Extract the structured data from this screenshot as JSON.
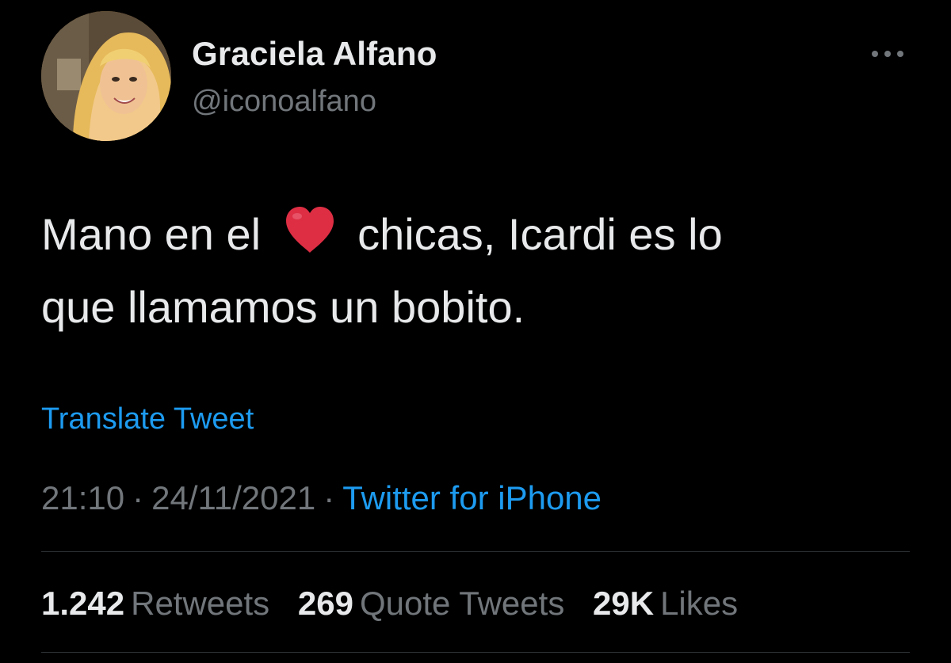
{
  "author": {
    "name": "Graciela Alfano",
    "handle": "@iconoalfano"
  },
  "tweet": {
    "text_before_emoji": "Mano en el",
    "emoji": "heart-emoji",
    "text_after_emoji": "chicas, Icardi es lo",
    "text_line2": "que llamamos un bobito."
  },
  "translate_label": "Translate Tweet",
  "meta": {
    "time": "21:10",
    "date": "24/11/2021",
    "separator": "·",
    "source": "Twitter for iPhone"
  },
  "stats": {
    "retweets": {
      "count": "1.242",
      "label": "Retweets"
    },
    "quotes": {
      "count": "269",
      "label": "Quote Tweets"
    },
    "likes": {
      "count": "29K",
      "label": "Likes"
    }
  },
  "colors": {
    "background": "#000000",
    "text": "#e7e9ea",
    "secondary": "#71767b",
    "accent": "#1d9bf0",
    "divider": "#2f3336",
    "heart": "#dd2e44"
  },
  "icons": {
    "more": "more-horizontal-icon"
  }
}
